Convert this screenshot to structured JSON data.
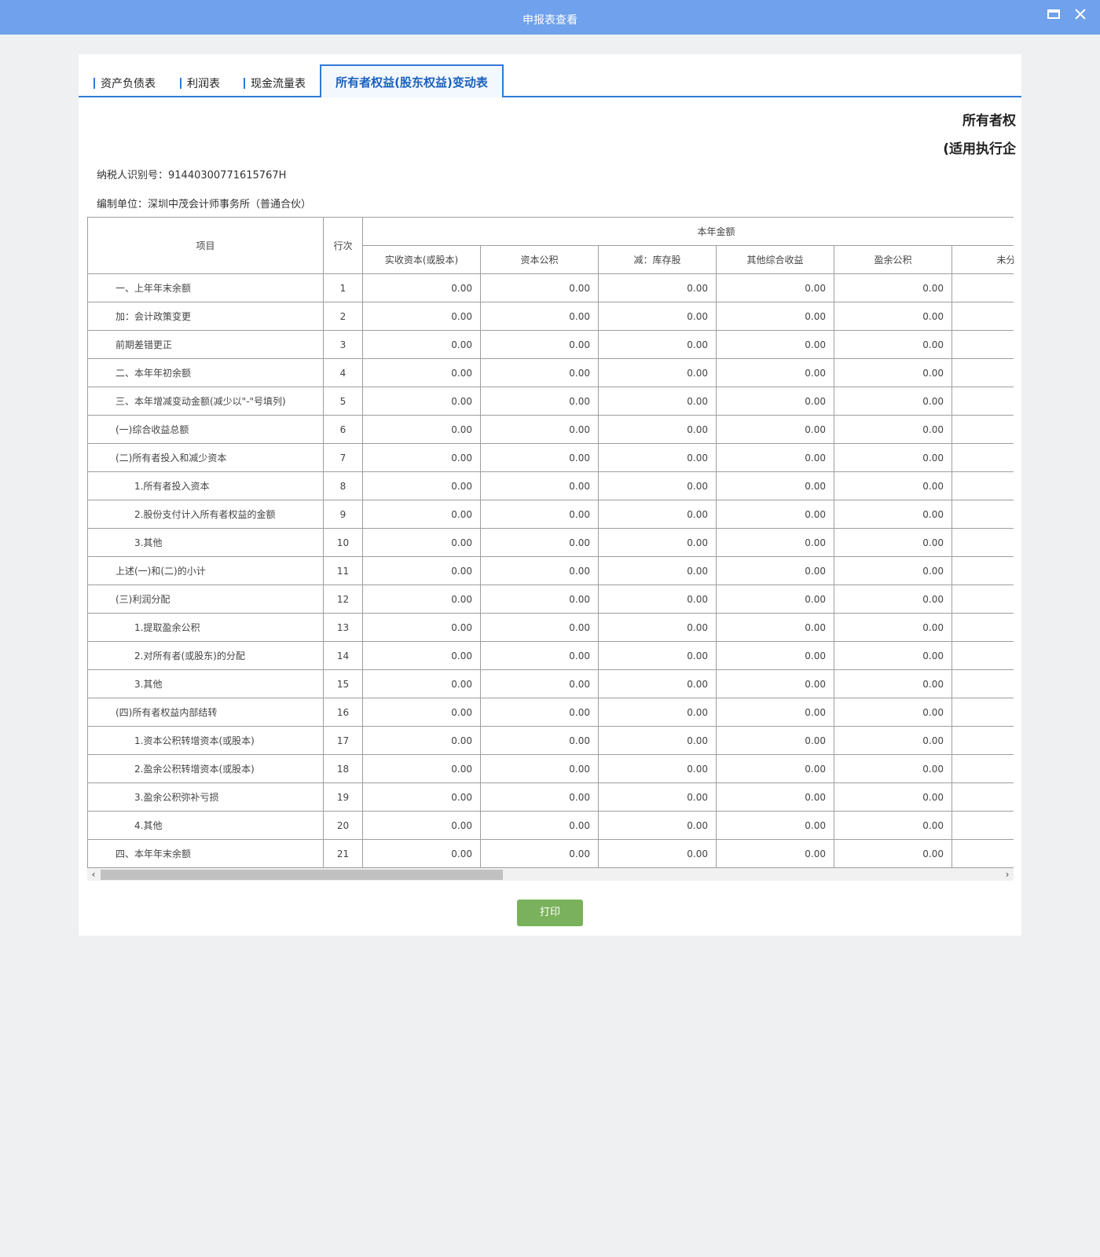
{
  "window": {
    "title": "申报表查看",
    "restore_icon": "restore-window-icon",
    "close_icon": "close-icon",
    "bar_color": "#6fa1ec"
  },
  "tabs": [
    {
      "label": "资产负债表",
      "active": false
    },
    {
      "label": "利润表",
      "active": false
    },
    {
      "label": "现金流量表",
      "active": false
    },
    {
      "label": "所有者权益(股东权益)变动表",
      "active": true
    }
  ],
  "report": {
    "title": "所有者权",
    "subtitle": "(适用执行企",
    "taxpayer_id_label": "纳税人识别号：",
    "taxpayer_id": "91440300771615767H",
    "preparer_label": "编制单位：",
    "preparer": "深圳中茂会计师事务所（普通合伙）"
  },
  "table": {
    "col_item": "项目",
    "col_rowno": "行次",
    "group_header": "本年金额",
    "sub_headers": [
      "实收资本(或股本)",
      "资本公积",
      "减：库存股",
      "其他综合收益",
      "盈余公积",
      "未分配"
    ],
    "rows": [
      {
        "item": "一、上年年末余额",
        "no": "1",
        "indent": false,
        "values": [
          "0.00",
          "0.00",
          "0.00",
          "0.00",
          "0.00",
          ""
        ]
      },
      {
        "item": "加：会计政策变更",
        "no": "2",
        "indent": false,
        "values": [
          "0.00",
          "0.00",
          "0.00",
          "0.00",
          "0.00",
          ""
        ]
      },
      {
        "item": "前期差错更正",
        "no": "3",
        "indent": false,
        "values": [
          "0.00",
          "0.00",
          "0.00",
          "0.00",
          "0.00",
          ""
        ]
      },
      {
        "item": "二、本年年初余额",
        "no": "4",
        "indent": false,
        "values": [
          "0.00",
          "0.00",
          "0.00",
          "0.00",
          "0.00",
          ""
        ]
      },
      {
        "item": "三、本年增减变动金额(减少以\"-\"号填列)",
        "no": "5",
        "indent": false,
        "values": [
          "0.00",
          "0.00",
          "0.00",
          "0.00",
          "0.00",
          ""
        ]
      },
      {
        "item": "(一)综合收益总额",
        "no": "6",
        "indent": false,
        "values": [
          "0.00",
          "0.00",
          "0.00",
          "0.00",
          "0.00",
          ""
        ]
      },
      {
        "item": "(二)所有者投入和减少资本",
        "no": "7",
        "indent": false,
        "values": [
          "0.00",
          "0.00",
          "0.00",
          "0.00",
          "0.00",
          ""
        ]
      },
      {
        "item": "1.所有者投入资本",
        "no": "8",
        "indent": true,
        "values": [
          "0.00",
          "0.00",
          "0.00",
          "0.00",
          "0.00",
          ""
        ]
      },
      {
        "item": "2.股份支付计入所有者权益的金额",
        "no": "9",
        "indent": true,
        "values": [
          "0.00",
          "0.00",
          "0.00",
          "0.00",
          "0.00",
          ""
        ]
      },
      {
        "item": "3.其他",
        "no": "10",
        "indent": true,
        "values": [
          "0.00",
          "0.00",
          "0.00",
          "0.00",
          "0.00",
          ""
        ]
      },
      {
        "item": "上述(一)和(二)的小计",
        "no": "11",
        "indent": false,
        "values": [
          "0.00",
          "0.00",
          "0.00",
          "0.00",
          "0.00",
          ""
        ]
      },
      {
        "item": "(三)利润分配",
        "no": "12",
        "indent": false,
        "values": [
          "0.00",
          "0.00",
          "0.00",
          "0.00",
          "0.00",
          ""
        ]
      },
      {
        "item": "1.提取盈余公积",
        "no": "13",
        "indent": true,
        "values": [
          "0.00",
          "0.00",
          "0.00",
          "0.00",
          "0.00",
          ""
        ]
      },
      {
        "item": "2.对所有者(或股东)的分配",
        "no": "14",
        "indent": true,
        "values": [
          "0.00",
          "0.00",
          "0.00",
          "0.00",
          "0.00",
          ""
        ]
      },
      {
        "item": "3.其他",
        "no": "15",
        "indent": true,
        "values": [
          "0.00",
          "0.00",
          "0.00",
          "0.00",
          "0.00",
          ""
        ]
      },
      {
        "item": "(四)所有者权益内部结转",
        "no": "16",
        "indent": false,
        "values": [
          "0.00",
          "0.00",
          "0.00",
          "0.00",
          "0.00",
          ""
        ]
      },
      {
        "item": "1.资本公积转增资本(或股本)",
        "no": "17",
        "indent": true,
        "values": [
          "0.00",
          "0.00",
          "0.00",
          "0.00",
          "0.00",
          ""
        ]
      },
      {
        "item": "2.盈余公积转增资本(或股本)",
        "no": "18",
        "indent": true,
        "values": [
          "0.00",
          "0.00",
          "0.00",
          "0.00",
          "0.00",
          ""
        ]
      },
      {
        "item": "3.盈余公积弥补亏损",
        "no": "19",
        "indent": true,
        "values": [
          "0.00",
          "0.00",
          "0.00",
          "0.00",
          "0.00",
          ""
        ]
      },
      {
        "item": "4.其他",
        "no": "20",
        "indent": true,
        "values": [
          "0.00",
          "0.00",
          "0.00",
          "0.00",
          "0.00",
          ""
        ]
      },
      {
        "item": "四、本年年末余额",
        "no": "21",
        "indent": false,
        "values": [
          "0.00",
          "0.00",
          "0.00",
          "0.00",
          "0.00",
          ""
        ]
      }
    ]
  },
  "scrollbar": {
    "left_icon": "scroll-left-arrow-icon",
    "right_icon": "scroll-right-arrow-icon",
    "left_glyph": "‹",
    "right_glyph": "›"
  },
  "actions": {
    "print_label": "打印",
    "print_color": "#7ab15c"
  },
  "colors": {
    "accent": "#2f7ad6",
    "active_tab_text": "#1a60bd",
    "background": "#eef0f2"
  }
}
